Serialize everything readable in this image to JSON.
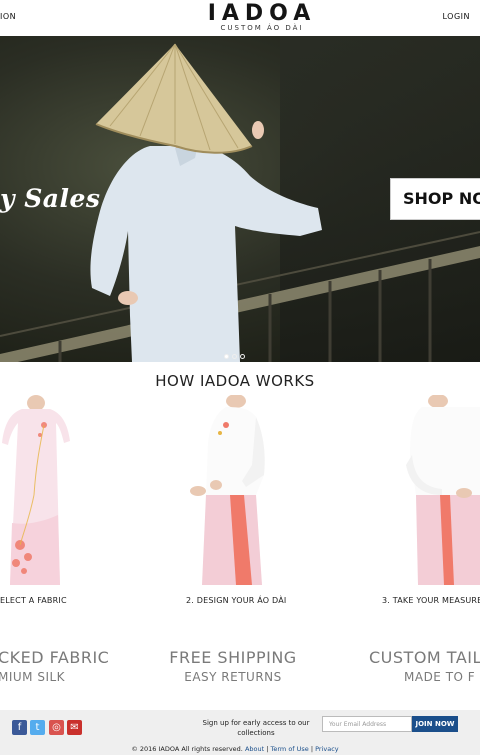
{
  "header": {
    "nav_left": "ION",
    "login": "LOGIN",
    "logo_main": "IADOA",
    "logo_sub": "CUSTOM ÁO DÀI"
  },
  "hero": {
    "headline": "y Sales",
    "cta": "SHOP NO",
    "slides": 3,
    "active_slide": 1
  },
  "how": {
    "title": "HOW IADOA WORKS",
    "steps": [
      {
        "label": "ELECT A FABRIC"
      },
      {
        "label": "2. DESIGN YOUR ÁO DÀI"
      },
      {
        "label": "3. TAKE YOUR MEASURE"
      }
    ]
  },
  "features": [
    {
      "main": "CKED FABRIC",
      "sub": "MIUM SILK"
    },
    {
      "main": "FREE SHIPPING",
      "sub": "EASY RETURNS"
    },
    {
      "main": "CUSTOM TAIL",
      "sub": "MADE TO F"
    }
  ],
  "footer": {
    "social": [
      {
        "name": "facebook-icon",
        "glyph": "f",
        "color": "#3b5998"
      },
      {
        "name": "twitter-icon",
        "glyph": "t",
        "color": "#55acee"
      },
      {
        "name": "instagram-icon",
        "glyph": "◎",
        "color": "#d9534f"
      },
      {
        "name": "email-icon",
        "glyph": "✉",
        "color": "#c9302c"
      }
    ],
    "signup_text": "Sign up for early access to our collections",
    "email_placeholder": "Your Email Address",
    "join_label": "JOIN NOW",
    "copyright": "© 2016 IADOA All rights reserved.",
    "links": [
      "About",
      "Term of Use",
      "Privacy"
    ]
  },
  "colors": {
    "accent": "#1b4f8b",
    "dress_pink": "#f4c6cf",
    "dress_coral": "#f07a6a",
    "feature_gray": "#7a7a7a"
  }
}
